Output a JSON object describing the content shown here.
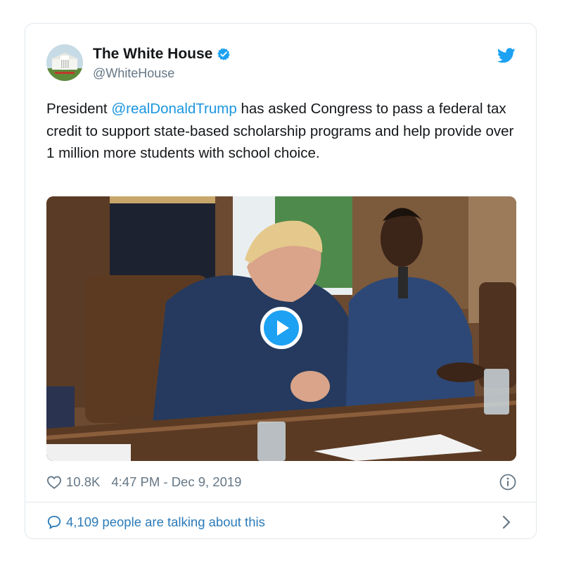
{
  "tweet": {
    "author_name": "The White House",
    "handle": "@WhiteHouse",
    "text_before_mention": "President ",
    "mention": "@realDonaldTrump",
    "text_after_mention": " has asked Congress to pass a federal tax credit to support state-based scholarship programs and help provide over 1 million more students with school choice.",
    "likes": "10.8K",
    "timestamp": "4:47 PM - Dec 9, 2019",
    "conversation": "4,109 people are talking about this"
  },
  "icons": {
    "verified": "verified-badge-icon",
    "brand": "twitter-bird-icon",
    "like": "heart-icon",
    "info": "info-icon",
    "reply": "speech-bubble-icon",
    "more": "chevron-right-icon",
    "play": "play-icon"
  },
  "colors": {
    "accent": "#1da1f2",
    "link": "#1b95e0",
    "muted": "#657786",
    "conversation": "#2b7bb9",
    "border": "#e1e8ed"
  }
}
